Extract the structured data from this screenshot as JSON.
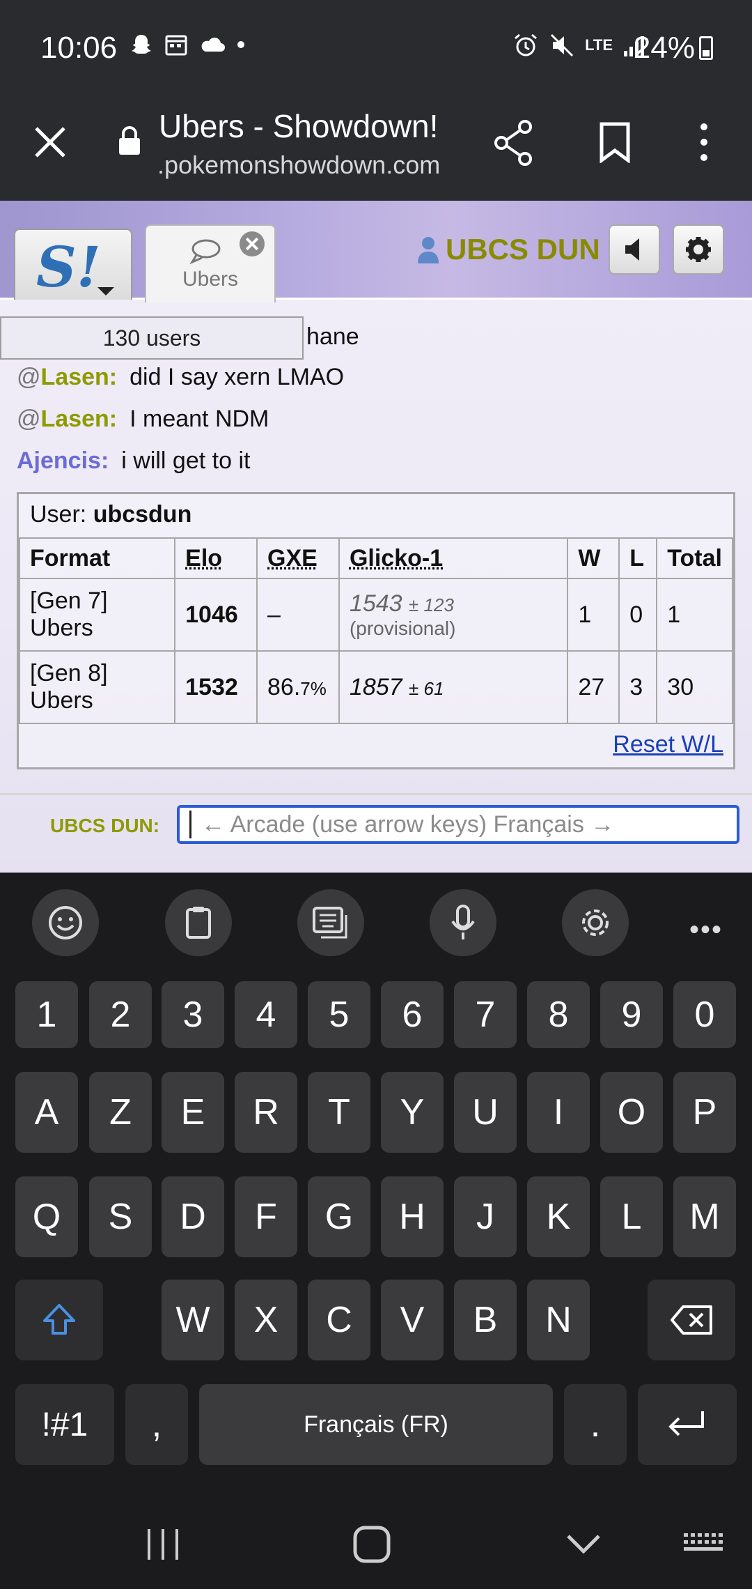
{
  "status_bar": {
    "time": "10:06",
    "battery": "24%",
    "network": "LTE"
  },
  "browser": {
    "title": "Ubers - Showdown!",
    "url": ".pokemonshowdown.com"
  },
  "header": {
    "tab_label": "Ubers",
    "username": "UBCS DUN"
  },
  "chat": {
    "users_count": "130 users",
    "partial_text": "hane",
    "messages": [
      {
        "prefix": "@",
        "author": "Lasen:",
        "text": "did I say xern LMAO"
      },
      {
        "prefix": "@",
        "author": "Lasen:",
        "text": "I meant NDM"
      },
      {
        "prefix": "",
        "author": "Ajencis:",
        "text": "i will get to it"
      }
    ]
  },
  "rankings": {
    "user_label": "User:",
    "user_name": "ubcsdun",
    "headers": [
      "Format",
      "Elo",
      "GXE",
      "Glicko-1",
      "W",
      "L",
      "Total"
    ],
    "rows": [
      {
        "format_line1": "[Gen 7]",
        "format_line2": "Ubers",
        "elo": "1046",
        "gxe": "–",
        "gxe_pct": "",
        "glicko": "1543",
        "glicko_dev": "± 123",
        "glicko_note": "(provisional)",
        "w": "1",
        "l": "0",
        "total": "1"
      },
      {
        "format_line1": "[Gen 8]",
        "format_line2": "Ubers",
        "elo": "1532",
        "gxe": "86.",
        "gxe_pct": "7%",
        "glicko": "1857",
        "glicko_dev": "± 61",
        "glicko_note": "",
        "w": "27",
        "l": "3",
        "total": "30"
      }
    ],
    "reset_link": "Reset W/L"
  },
  "chat_input": {
    "label": "UBCS DUN:",
    "placeholder": "← Arcade (use arrow keys) Français →"
  },
  "keyboard": {
    "number_row": [
      "1",
      "2",
      "3",
      "4",
      "5",
      "6",
      "7",
      "8",
      "9",
      "0"
    ],
    "row1": [
      "A",
      "Z",
      "E",
      "R",
      "T",
      "Y",
      "U",
      "I",
      "O",
      "P"
    ],
    "row2": [
      "Q",
      "S",
      "D",
      "F",
      "G",
      "H",
      "J",
      "K",
      "L",
      "M"
    ],
    "row3": [
      "W",
      "X",
      "C",
      "V",
      "B",
      "N"
    ],
    "symbols_key": "!#1",
    "comma_key": ",",
    "space_label": "Français (FR)",
    "period_key": ".",
    "toolbar_more": "•••"
  },
  "colors": {
    "accent_user": "#8e9a00",
    "link": "#1a3fb8",
    "focus": "#2c5bd6"
  }
}
